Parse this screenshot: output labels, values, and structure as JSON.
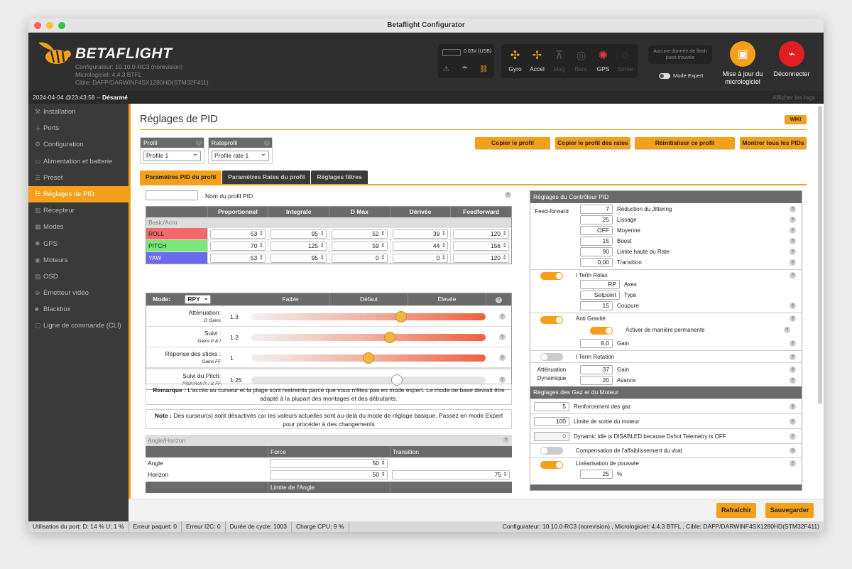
{
  "window": {
    "title": "Betaflight Configurator"
  },
  "header": {
    "brand": "BETAFLIGHT",
    "config_version": "Configurateur: 10.10.0-RC3 (norevision)",
    "firmware": "Micrologiciel: 4.4.3 BTFL",
    "target": "Cible: DAFP/DARWINF4SX1280HD(STM32F411)",
    "voltage": "0.03V (USB)",
    "no_flash": "Aucune donnée de flash puce trouvée",
    "expert_mode": "Mode Expert",
    "update_fw": "Mise à jour du micrologiciel",
    "disconnect": "Déconnecter",
    "sensors": [
      {
        "label": "Gyro",
        "icon": "gyro-icon",
        "on": true
      },
      {
        "label": "Accel",
        "icon": "accel-icon",
        "on": true
      },
      {
        "label": "Mag",
        "icon": "mag-icon",
        "on": false
      },
      {
        "label": "Baro",
        "icon": "baro-icon",
        "on": false
      },
      {
        "label": "GPS",
        "icon": "gps-icon",
        "on": true
      },
      {
        "label": "Sonar",
        "icon": "sonar-icon",
        "on": false
      }
    ]
  },
  "status": {
    "datetime": "2024-04-04 @23:43:58 -- ",
    "armed": "Désarmé",
    "show_logs": "Afficher les logs"
  },
  "sidebar": {
    "items": [
      "Installation",
      "Ports",
      "Configuration",
      "Alimentation et batterie",
      "Preset",
      "Réglages de PID",
      "Récepteur",
      "Modes",
      "GPS",
      "Moteurs",
      "OSD",
      "Émetteur vidéo",
      "Blackbox",
      "Ligne de commande (CLI)"
    ]
  },
  "page": {
    "title": "Réglages de PID",
    "wiki": "WIKI",
    "profile_label": "Profil",
    "profile_value": "Profile 1",
    "rateprofile_label": "Rateprofil",
    "rateprofile_value": "Profile rate 1",
    "buttons": {
      "copy_profile": "Copier le profil",
      "copy_rates": "Copier le profil des rates",
      "reset_profile": "Réinitialiser ce profil",
      "show_all": "Montrer tous les PIDs"
    },
    "tabs": [
      "Paramètres PID du profil",
      "Paramètres Rates du profil",
      "Réglages filtres"
    ],
    "profile_name_label": "Nom du profil PID"
  },
  "pid_table": {
    "headers": [
      "",
      "Proportionnel",
      "Integrale",
      "D Max",
      "Dérivée",
      "Feedforward"
    ],
    "section": "Basic/Acro",
    "rows": [
      {
        "axis": "ROLL",
        "color": "#f06a6a",
        "values": [
          "53",
          "95",
          "52",
          "39",
          "120"
        ]
      },
      {
        "axis": "PITCH",
        "color": "#78e878",
        "values": [
          "70",
          "125",
          "59",
          "44",
          "156"
        ]
      },
      {
        "axis": "YAW",
        "color": "#6a6af0",
        "values": [
          "53",
          "95",
          "0",
          "0",
          "120"
        ]
      }
    ]
  },
  "sliders": {
    "mode_label": "Mode:",
    "mode_value": "RPY",
    "headers": [
      "Faible",
      "Défaut",
      "Élevée"
    ],
    "rows": [
      {
        "label": "Atténuation:",
        "sub": "D Gains",
        "value": "1.3",
        "pos": 0.64,
        "enabled": true
      },
      {
        "label": "Suivi :",
        "sub": "Gains P & I",
        "value": "1.2",
        "pos": 0.59,
        "enabled": true
      },
      {
        "label": "Réponse des sticks :",
        "sub": "Gains FF",
        "value": "1",
        "pos": 0.5,
        "enabled": true
      },
      {
        "label": "Suivi du Pitch:",
        "sub": "Pitch:Roll P, I & FF",
        "value": "1.25",
        "pos": 0.62,
        "enabled": false
      }
    ]
  },
  "notes": {
    "remark_bold": "Remarque :",
    "remark": " L'accès au curseur et la plage sont restreints parce que vous n'êtes pas en mode expert. Le mode de base devrait être adapté à la plupart des montages et des débutants.",
    "note_bold": "Note :",
    "note": " Des curseur(s) sont désactivés car les valeurs actuelles sont au-delà du mode de réglage basique. Passez en mode Expert pour procéder à des changements"
  },
  "angle": {
    "header": "Angle/Horizon",
    "force": "Force",
    "transition": "Transition",
    "angle_label": "Angle",
    "angle_force": "50",
    "horizon_label": "Horizon",
    "horizon_force": "50",
    "horizon_transition": "75",
    "limit": "Limite de l'Angle"
  },
  "controller": {
    "header": "Réglages du Contrôleur PID",
    "feedforward_label": "Feed-forward",
    "ff": [
      {
        "value": "7",
        "label": "Réduction du Jittering"
      },
      {
        "value": "25",
        "label": "Lissage"
      },
      {
        "value": "OFF",
        "label": "Moyenne"
      },
      {
        "value": "15",
        "label": "Boost"
      },
      {
        "value": "90",
        "label": "Limite haute du Rate"
      },
      {
        "value": "0,00",
        "label": "Transition"
      }
    ],
    "iterm_relax": "I Term Relax",
    "iterm_axes_value": "RP",
    "iterm_axes": "Axes",
    "iterm_type_value": "Setpoint",
    "iterm_type": "Type",
    "iterm_cutoff_value": "15",
    "iterm_cutoff": "Coupure",
    "anti_gravity": "Anti Gravité",
    "ag_permanent": "Activer de manière permanente",
    "ag_gain_value": "8,0",
    "ag_gain": "Gain",
    "iterm_rotation": "I Term Rotation",
    "dyn_label": "Atténuation Dynamique",
    "dyn_gain_value": "37",
    "dyn_gain": "Gain",
    "dyn_adv_value": "20",
    "dyn_adv": "Avance"
  },
  "throttle": {
    "header": "Réglages des Gaz et du Moteur",
    "boost_value": "5",
    "boost": "Renforcement des gaz",
    "limit_value": "100",
    "limit": "Limite de sortie du moteur",
    "idle_value": "0",
    "idle": "Dynamic Idle is DISABLED because Dshot Telemetry is OFF",
    "vbat": "Compensation de l'affaiblissement du vbat",
    "linear": "Linéarisation de poussée",
    "linear_value": "25",
    "linear_unit": "%"
  },
  "footer": {
    "refresh": "Rafraîchir",
    "save": "Sauvegarder"
  },
  "statusbar": {
    "port": "Utilisation du port: D: 14 % U: 1 %",
    "packet": "Erreur paquet: 0",
    "i2c": "Erreur I2C: 0",
    "cycle": "Durée de cycle: 1003",
    "cpu": "Charge CPU: 9 %",
    "version": "Configurateur: 10.10.0-RC3 (norevision) , Micrologiciel: 4.4.3 BTFL , Cible: DAFP/DARWINF4SX1280HD(STM32F411)"
  }
}
